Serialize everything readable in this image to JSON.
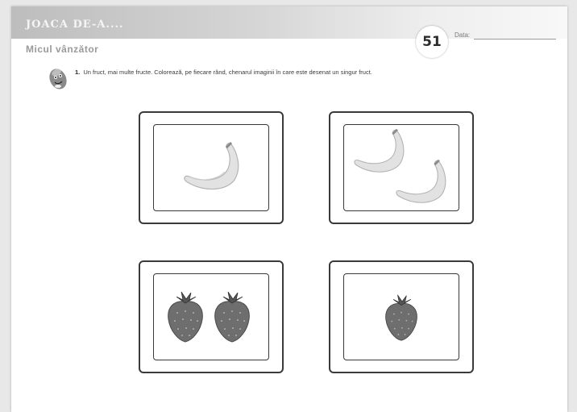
{
  "header": {
    "title": "JOACA DE-A....",
    "subtitle": "Micul vânzător",
    "page_number": "51",
    "date_label": "Data:"
  },
  "exercise": {
    "number": "1.",
    "text": "Un fruct, mai multe fructe. Colorează, pe fiecare rând, chenarul imaginii în care este desenat un singur fruct.",
    "icon": "pencil-eraser-icon"
  },
  "cards": [
    {
      "fruit": "banana",
      "count": 1
    },
    {
      "fruit": "banana",
      "count": 2
    },
    {
      "fruit": "strawberry",
      "count": 2
    },
    {
      "fruit": "strawberry",
      "count": 1
    }
  ],
  "colors": {
    "banana": "#dedede",
    "strawberry": "#6e6e6e",
    "border": "#3a3a3a"
  }
}
